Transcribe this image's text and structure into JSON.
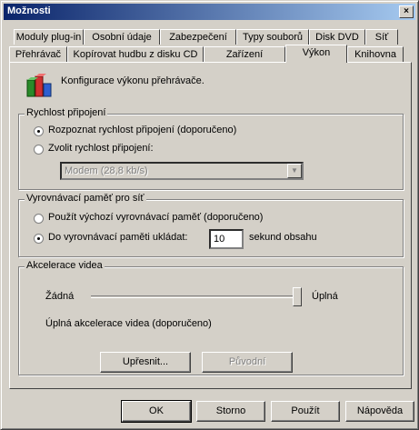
{
  "window": {
    "title": "Možnosti",
    "close_glyph": "×"
  },
  "tabs_row1": [
    "Moduly plug-in",
    "Osobní údaje",
    "Zabezpečení",
    "Typy souborů",
    "Disk DVD",
    "Síť"
  ],
  "tabs_row2": [
    "Přehrávač",
    "Kopírovat hudbu z disku CD",
    "Zařízení",
    "Výkon",
    "Knihovna"
  ],
  "active_tab": "Výkon",
  "header": {
    "text": "Konfigurace výkonu přehrávače."
  },
  "connection": {
    "title": "Rychlost připojení",
    "detect_label": "Rozpoznat rychlost připojení (doporučeno)",
    "choose_label": "Zvolit rychlost připojení:",
    "selected_speed": "Modem (28,8 kb/s)",
    "selected_option": "detect"
  },
  "buffer": {
    "title": "Vyrovnávací paměť pro síť",
    "default_label": "Použít výchozí vyrovnávací paměť (doporučeno)",
    "custom_label": "Do vyrovnávací paměti ukládat:",
    "seconds_value": "10",
    "seconds_suffix": "sekund obsahu",
    "selected_option": "custom"
  },
  "video": {
    "title": "Akcelerace videa",
    "min_label": "Žádná",
    "max_label": "Úplná",
    "level_fraction": 1.0,
    "status": "Úplná akcelerace videa (doporučeno)",
    "advanced_button": "Upřesnit...",
    "defaults_button": "Původní"
  },
  "footer": {
    "ok": "OK",
    "cancel": "Storno",
    "apply": "Použít",
    "help": "Nápověda"
  }
}
